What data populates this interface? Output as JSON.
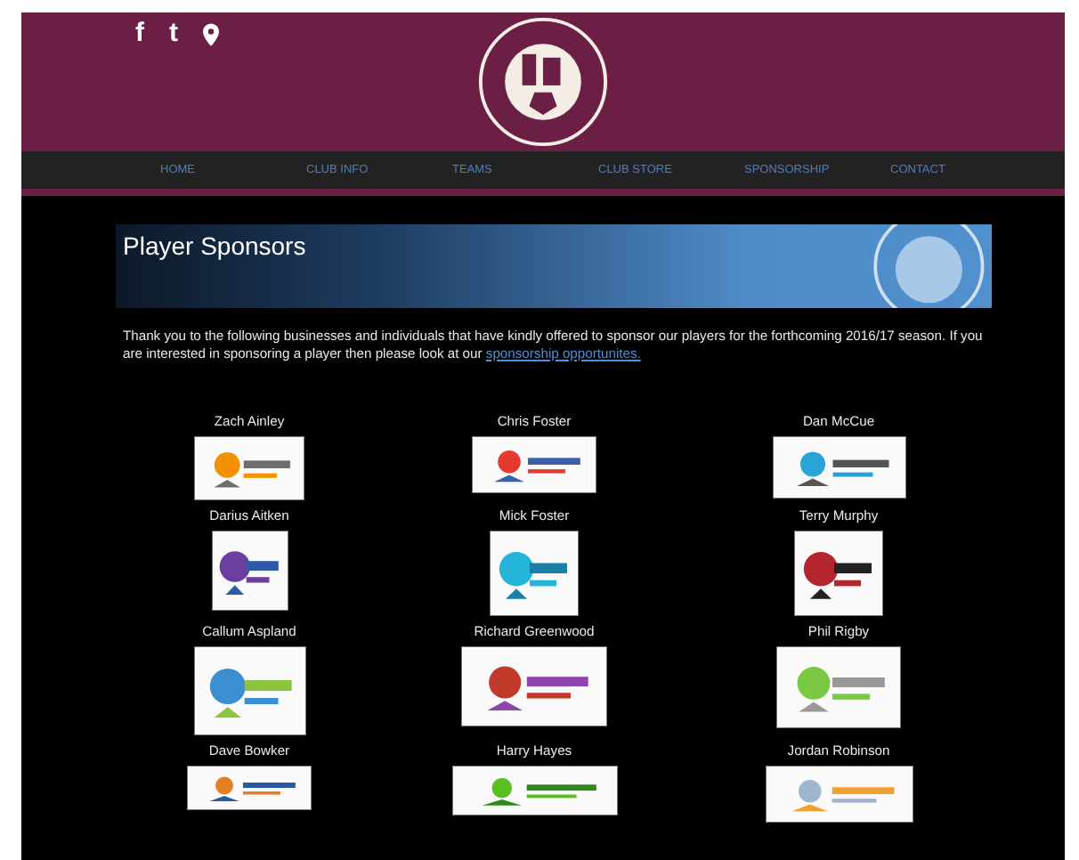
{
  "header": {
    "social": [
      "f",
      "t"
    ]
  },
  "nav": [
    "HOME",
    "CLUB INFO",
    "TEAMS",
    "CLUB STORE",
    "SPONSORSHIP",
    "CONTACT"
  ],
  "banner": {
    "title": "Player Sponsors"
  },
  "intro": {
    "text": "Thank you to the following businesses and individuals that have kindly offered to sponsor our players for the forthcoming 2016/17 season. If you are interested in sponsoring a player then please look at our",
    "link": "sponsorship opportunites."
  },
  "sponsors": [
    {
      "name": "Zach Ainley"
    },
    {
      "name": "Chris Foster"
    },
    {
      "name": "Dan McCue"
    },
    {
      "name": "Darius Aitken"
    },
    {
      "name": "Mick Foster"
    },
    {
      "name": "Terry Murphy"
    },
    {
      "name": "Callum Aspland"
    },
    {
      "name": "Richard Greenwood"
    },
    {
      "name": "Phil Rigby"
    },
    {
      "name": "Dave Bowker"
    },
    {
      "name": "Harry Hayes"
    },
    {
      "name": "Jordan Robinson"
    }
  ]
}
